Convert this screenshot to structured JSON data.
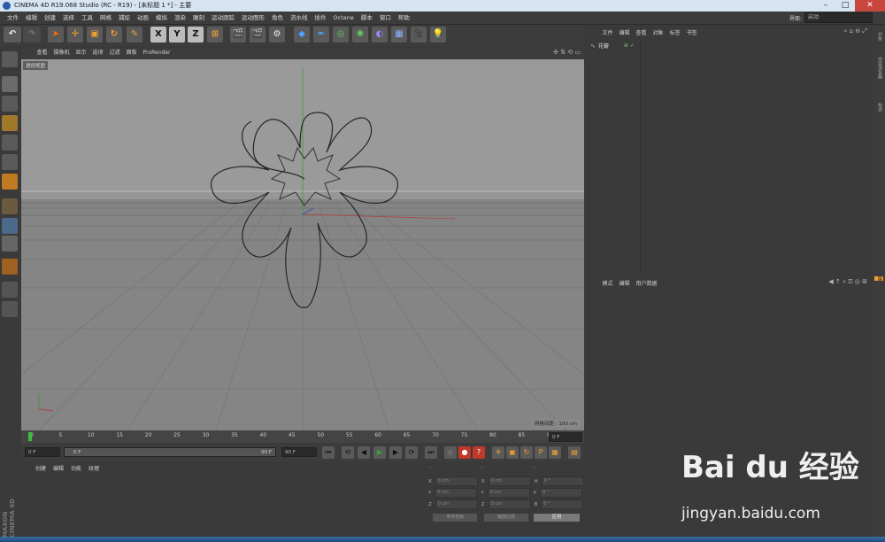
{
  "window": {
    "title": "CINEMA 4D R19.068 Studio (RC - R19) - [未标题 1 *] - 主要"
  },
  "menu": [
    "文件",
    "编辑",
    "创建",
    "选择",
    "工具",
    "网格",
    "捕捉",
    "动画",
    "模拟",
    "渲染",
    "雕刻",
    "运动跟踪",
    "运动图形",
    "角色",
    "流水线",
    "插件",
    "Octane",
    "脚本",
    "窗口",
    "帮助"
  ],
  "layout": {
    "label": "界面:",
    "value": "启动"
  },
  "viewport": {
    "menu": [
      "查看",
      "摄像机",
      "显示",
      "选项",
      "过滤",
      "面板",
      "ProRender"
    ],
    "label": "透视视图",
    "grid_info": "网格间距 : 100 cm"
  },
  "timeline": {
    "ticks": [
      "0",
      "5",
      "10",
      "15",
      "20",
      "25",
      "30",
      "35",
      "40",
      "45",
      "50",
      "55",
      "60",
      "65",
      "70",
      "75",
      "80",
      "85",
      "90"
    ],
    "end_field": "0 F"
  },
  "time_controls": {
    "start": "0 F",
    "current": "0 F",
    "range_end": "90 F",
    "end": "90 F"
  },
  "material_panel": {
    "tabs": [
      "创建",
      "编辑",
      "功能",
      "纹理"
    ]
  },
  "coord_panel": {
    "headers": [
      "---",
      "---",
      "---"
    ],
    "rows": [
      {
        "a": "X",
        "av": "0 cm",
        "b": "X",
        "bv": "0 cm",
        "c": "H",
        "cv": "0 °"
      },
      {
        "a": "Y",
        "av": "0 cm",
        "b": "Y",
        "bv": "0 cm",
        "c": "P",
        "cv": "0 °"
      },
      {
        "a": "Z",
        "av": "0 cm",
        "b": "Z",
        "bv": "0 cm",
        "c": "B",
        "cv": "0 °"
      }
    ],
    "mode1": "世界坐标",
    "mode2": "缩放比例",
    "apply": "应用"
  },
  "object_panel": {
    "tabs": [
      "文件",
      "编辑",
      "查看",
      "对象",
      "标签",
      "书签"
    ],
    "items": [
      {
        "name": "花瓣"
      }
    ]
  },
  "attr_panel": {
    "tabs": [
      "模式",
      "编辑",
      "用户数据"
    ]
  },
  "right_tabs": [
    "对象",
    "内容浏览器",
    "构造",
    "层"
  ],
  "brand": "MAXON CINEMA 4D",
  "watermark": {
    "logo": "Bai du 经验",
    "url": "jingyan.baidu.com"
  },
  "colors": {
    "accent": "#f0a030",
    "bg": "#3a3a3a",
    "viewport": "#8f8f8f"
  }
}
